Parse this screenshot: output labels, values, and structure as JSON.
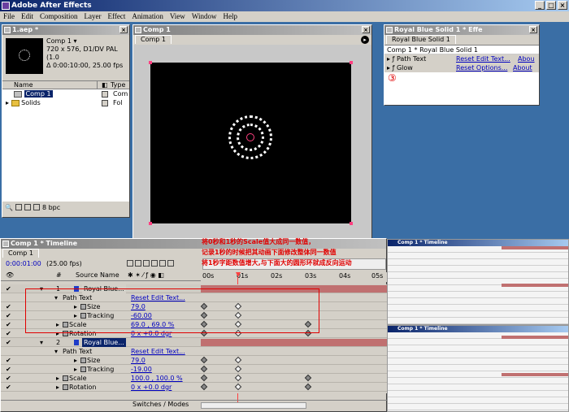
{
  "app": {
    "title": "Adobe After Effects"
  },
  "menu": [
    "File",
    "Edit",
    "Composition",
    "Layer",
    "Effect",
    "Animation",
    "View",
    "Window",
    "Help"
  ],
  "project": {
    "title": "1.aep *",
    "comp_name": "Comp 1",
    "comp_info_1": "720 x 576, D1/DV PAL (1.0",
    "comp_info_2": "Δ 0:00:10:00, 25.00 fps",
    "col_name": "Name",
    "col_type": "Type",
    "items": [
      {
        "name": "Comp 1",
        "type": "Com"
      },
      {
        "name": "Solids",
        "type": "Fol"
      }
    ],
    "bpc": "8 bpc"
  },
  "comp_window": {
    "title": "Comp 1",
    "tab": "Comp 1"
  },
  "effects": {
    "title": "Royal Blue Solid 1 * Effe",
    "tab": "Royal Blue Solid 1",
    "breadcrumb": "Comp 1 * Royal Blue Solid 1",
    "effects": [
      {
        "name": "Path Text",
        "reset": "Reset Edit Text...",
        "about": "Abou"
      },
      {
        "name": "Glow",
        "reset": "Reset Options...",
        "about": "About"
      }
    ],
    "marker": "③"
  },
  "annotations": [
    "将0秒和1秒的Scale值大成同一数值，",
    "记录1秒的时候把其动画下面修改整体同一数值",
    "将1秒字距数值增大,与下面大的圆形环就成反向运动"
  ],
  "timeline": {
    "title": "Comp 1 * Timeline",
    "tab": "Comp 1",
    "time": "0:00:01:00",
    "fps": "(25.00 fps)",
    "col_num": "#",
    "col_source": "Source Name",
    "ruler": [
      "00s",
      "01s",
      "02s",
      "03s",
      "04s",
      "05s"
    ],
    "switches_label": "Switches / Modes",
    "rows": [
      {
        "kind": "layer",
        "num": "1",
        "name": "Royal Blue...",
        "value": "",
        "bar": true
      },
      {
        "kind": "group",
        "num": "",
        "name": "Path Text",
        "value": "Reset Edit Text...",
        "bar": false
      },
      {
        "kind": "prop",
        "num": "",
        "name": "Size",
        "value": "79.0",
        "bar": false
      },
      {
        "kind": "prop",
        "num": "",
        "name": "Tracking",
        "value": "-60.00",
        "bar": false
      },
      {
        "kind": "tprop",
        "num": "",
        "name": "Scale",
        "value": "69.0 , 69.0 %",
        "bar": false
      },
      {
        "kind": "tprop",
        "num": "",
        "name": "Rotation",
        "value": "0 x +0.0 dgr",
        "bar": false
      },
      {
        "kind": "layer",
        "num": "2",
        "name": "Royal Blue...",
        "value": "",
        "bar": true
      },
      {
        "kind": "group",
        "num": "",
        "name": "Path Text",
        "value": "Reset Edit Text...",
        "bar": false
      },
      {
        "kind": "prop",
        "num": "",
        "name": "Size",
        "value": "79.0",
        "bar": false
      },
      {
        "kind": "prop",
        "num": "",
        "name": "Tracking",
        "value": "-19.00",
        "bar": false
      },
      {
        "kind": "tprop",
        "num": "",
        "name": "Scale",
        "value": "100.0 , 100.0 %",
        "bar": false
      },
      {
        "kind": "tprop",
        "num": "",
        "name": "Rotation",
        "value": "0 x +0.0 dgr",
        "bar": false
      }
    ]
  },
  "thumbs": [
    {
      "title": "Comp 1 * Timeline"
    },
    {
      "title": "Comp 1 * Timeline"
    }
  ],
  "colors": {
    "accent_red": "#e00000",
    "title_blue": "#0a246a",
    "layer_bar": "#c07070"
  }
}
